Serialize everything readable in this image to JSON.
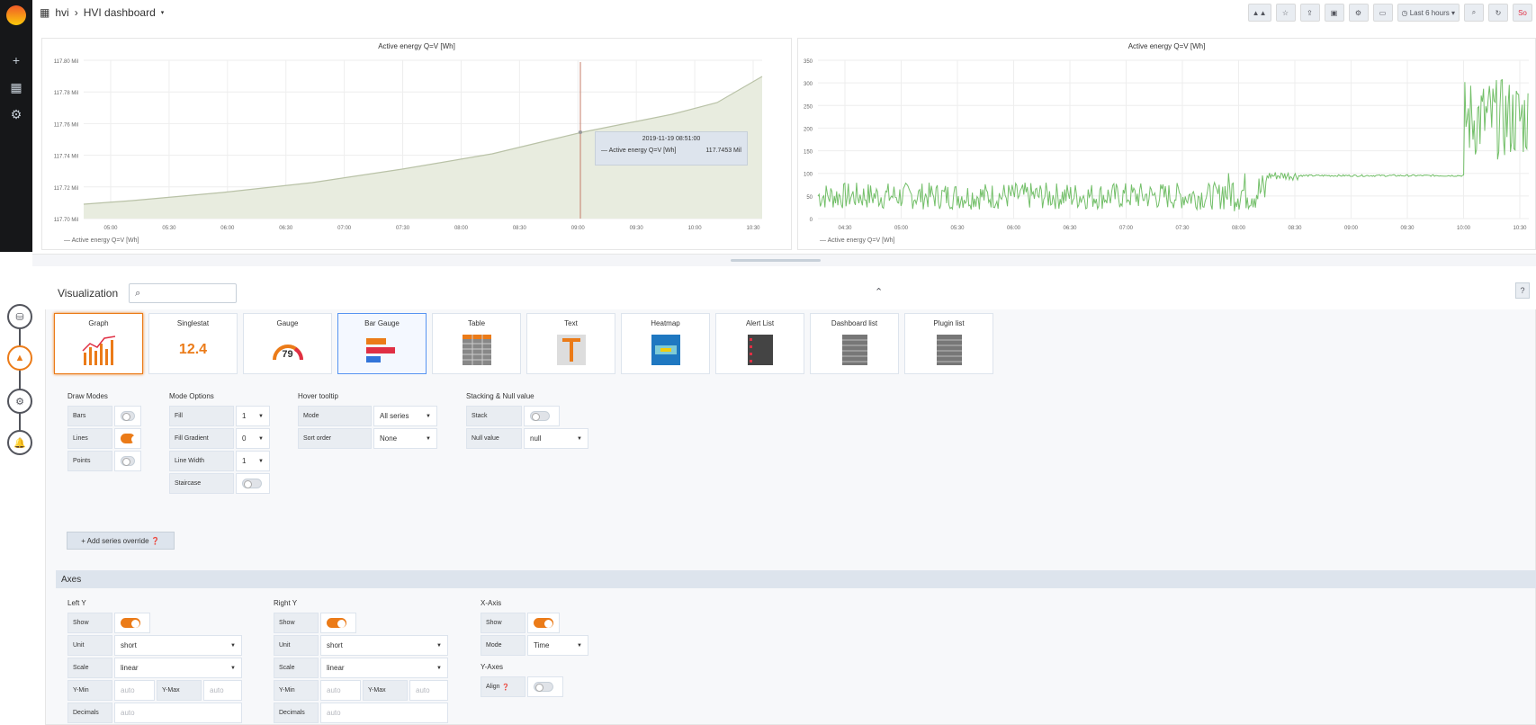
{
  "topbar": {
    "home": "hvi",
    "title": "HVI dashboard",
    "time_picker": "Last 6 hours",
    "user": "So"
  },
  "panel1": {
    "title": "Active energy Q=V [Wh]",
    "legend": "Active energy Q=V [Wh]",
    "yticks": [
      "117.80 Mil",
      "117.78 Mil",
      "117.76 Mil",
      "117.74 Mil",
      "117.72 Mil",
      "117.70 Mil"
    ],
    "xticks": [
      "05:00",
      "05:30",
      "06:00",
      "06:30",
      "07:00",
      "07:30",
      "08:00",
      "08:30",
      "09:00",
      "09:30",
      "10:00",
      "10:30"
    ],
    "tooltip": {
      "time": "2019-11-19 08:51:00",
      "series": "Active energy Q=V [Wh]",
      "value": "117.7453 Mil"
    }
  },
  "panel2": {
    "title": "Active energy Q=V [Wh]",
    "legend": "Active energy Q=V [Wh]",
    "yticks": [
      "350",
      "300",
      "250",
      "200",
      "150",
      "100",
      "50",
      "0"
    ],
    "xticks": [
      "04:30",
      "05:00",
      "05:30",
      "06:00",
      "06:30",
      "07:00",
      "07:30",
      "08:00",
      "08:30",
      "09:00",
      "09:30",
      "10:00",
      "10:30"
    ]
  },
  "viz": {
    "heading": "Visualization",
    "types": [
      "Graph",
      "Singlestat",
      "Gauge",
      "Bar Gauge",
      "Table",
      "Text",
      "Heatmap",
      "Alert List",
      "Dashboard list",
      "Plugin list"
    ],
    "singlestat_value": "12.4",
    "gauge_value": "79"
  },
  "draw_modes": {
    "title": "Draw Modes",
    "bars": "Bars",
    "lines": "Lines",
    "points": "Points"
  },
  "mode_options": {
    "title": "Mode Options",
    "fill": "Fill",
    "fill_val": "1",
    "fill_gradient": "Fill Gradient",
    "fill_gradient_val": "0",
    "line_width": "Line Width",
    "line_width_val": "1",
    "staircase": "Staircase"
  },
  "hover": {
    "title": "Hover tooltip",
    "mode": "Mode",
    "mode_val": "All series",
    "sort": "Sort order",
    "sort_val": "None"
  },
  "stacking": {
    "title": "Stacking & Null value",
    "stack": "Stack",
    "null_value": "Null value",
    "null_val": "null"
  },
  "add_override": "+ Add series override",
  "axes": {
    "title": "Axes",
    "left": {
      "title": "Left Y",
      "show": "Show",
      "unit": "Unit",
      "unit_val": "short",
      "scale": "Scale",
      "scale_val": "linear",
      "ymin": "Y-Min",
      "ymax": "Y-Max",
      "auto": "auto",
      "decimals": "Decimals"
    },
    "right": {
      "title": "Right Y",
      "show": "Show",
      "unit": "Unit",
      "unit_val": "short",
      "scale": "Scale",
      "scale_val": "linear",
      "ymin": "Y-Min",
      "ymax": "Y-Max",
      "auto": "auto",
      "decimals": "Decimals"
    },
    "x": {
      "title": "X-Axis",
      "show": "Show",
      "mode": "Mode",
      "mode_val": "Time"
    },
    "yaxes": {
      "title": "Y-Axes",
      "align": "Align"
    }
  },
  "colors": {
    "accent": "#eb7b18",
    "series1": "#e8ecdf",
    "series2": "#73bf69"
  }
}
